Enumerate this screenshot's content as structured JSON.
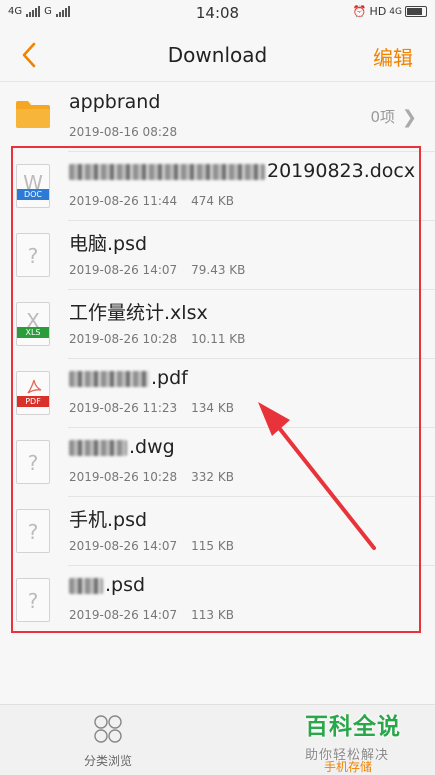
{
  "status_bar": {
    "left_net_1": "4G",
    "left_net_2": "G",
    "time": "14:08",
    "right_hd": "HD",
    "right_net": "4G"
  },
  "nav": {
    "back_icon": "chevron-left-icon",
    "title": "Download",
    "edit_label": "编辑"
  },
  "folder": {
    "icon": "folder-icon",
    "name": "appbrand",
    "date": "2019-08-16 08:28",
    "count": "0项"
  },
  "files": [
    {
      "icon": "word-doc-icon",
      "type_tag": "DOC",
      "name": "20190823.docx",
      "date": "2019-08-26 11:44",
      "size": "474 KB"
    },
    {
      "icon": "unknown-file-icon",
      "type_tag": "",
      "name": "电脑.psd",
      "date": "2019-08-26 14:07",
      "size": "79.43 KB"
    },
    {
      "icon": "excel-xls-icon",
      "type_tag": "XLS",
      "name": "工作量统计.xlsx",
      "date": "2019-08-26 10:28",
      "size": "10.11 KB"
    },
    {
      "icon": "pdf-icon",
      "type_tag": "PDF",
      "name": ".pdf",
      "date": "2019-08-26 11:23",
      "size": "134 KB"
    },
    {
      "icon": "unknown-file-icon",
      "type_tag": "",
      "name": ".dwg",
      "date": "2019-08-26 10:28",
      "size": "332 KB"
    },
    {
      "icon": "unknown-file-icon",
      "type_tag": "",
      "name": "手机.psd",
      "date": "2019-08-26 14:07",
      "size": "115 KB"
    },
    {
      "icon": "unknown-file-icon",
      "type_tag": "",
      "name": ".psd",
      "date": "2019-08-26 14:07",
      "size": "113 KB"
    }
  ],
  "bottom_tabs": {
    "browse_label": "分类浏览",
    "recent_label": "手机存储"
  },
  "watermark": {
    "main": "百科全说",
    "sub": "助你轻松解决"
  },
  "colors": {
    "accent": "#f08300",
    "annotation": "#e8333a",
    "folder": "#f5a623",
    "doc_tag": "#2b7bd6",
    "xls_tag": "#2a9d3a",
    "pdf_tag": "#d9302a"
  }
}
